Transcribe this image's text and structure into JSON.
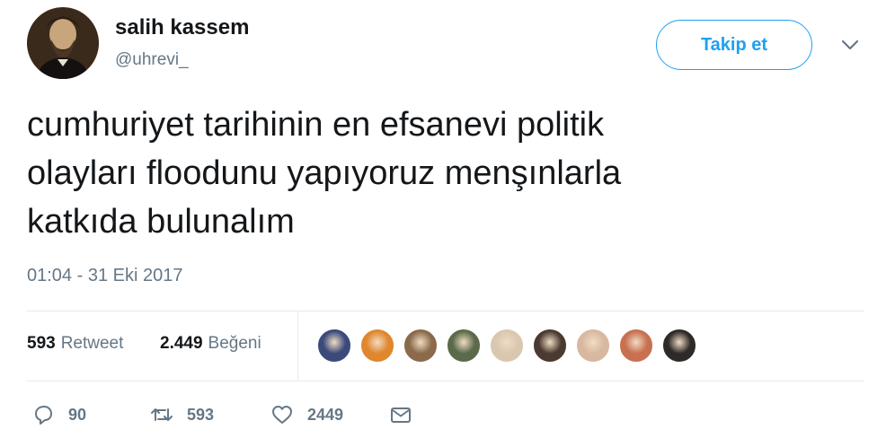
{
  "author": {
    "display_name": "salih kassem",
    "handle": "@uhrevi_",
    "avatar_icon": "profile-portrait"
  },
  "follow_button": {
    "label": "Takip et",
    "color": "#1da1f2"
  },
  "tweet": {
    "text": "cumhuriyet tarihinin en efsanevi politik\nolayları floodunu yapıyoruz menşınlarla\nkatkıda bulunalım",
    "timestamp": "01:04 - 31 Eki 2017"
  },
  "stats": {
    "retweets_count": "593",
    "retweets_label": "Retweet",
    "likes_count": "2.449",
    "likes_label": "Beğeni"
  },
  "likers": [
    {
      "icon": "liker-avatar",
      "color": "#3b4a7a"
    },
    {
      "icon": "liker-avatar",
      "color": "#e0862e"
    },
    {
      "icon": "liker-avatar",
      "color": "#8a6a4a"
    },
    {
      "icon": "liker-avatar",
      "color": "#5a6a4a"
    },
    {
      "icon": "liker-avatar",
      "color": "#d9c7b0"
    },
    {
      "icon": "liker-avatar",
      "color": "#4a3a30"
    },
    {
      "icon": "liker-avatar",
      "color": "#d8b8a0"
    },
    {
      "icon": "liker-avatar",
      "color": "#c87050"
    },
    {
      "icon": "liker-avatar",
      "color": "#2e2a2a"
    }
  ],
  "actions": {
    "reply_count": "90",
    "retweet_count": "593",
    "like_count": "2449"
  },
  "colors": {
    "accent": "#1da1f2",
    "muted": "#657786",
    "text": "#14171a",
    "border": "#e6ecf0"
  }
}
